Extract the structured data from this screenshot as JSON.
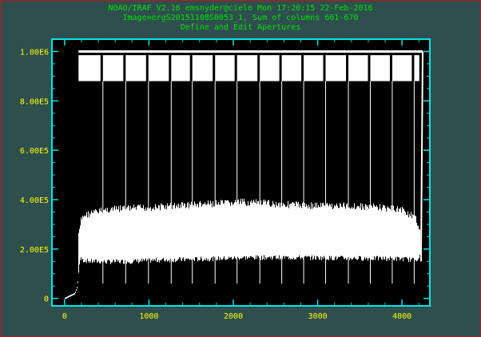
{
  "header": {
    "line1": "NOAO/IRAF V2.16 emsnyder@cielo Mon 17:20:15 22-Feb-2016",
    "line2": "Image=ergS20151108S0053_1, Sum of columns 661-670",
    "line3": "Define and Edit Apertures"
  },
  "colors": {
    "background": "#2f4f4f",
    "axes": "#00e5e5",
    "tick_labels": "#ffff00",
    "header_text": "#00e600",
    "plot_area": "#000000",
    "data": "#ffffff",
    "window_border": "#c01616"
  },
  "chart_data": {
    "type": "line",
    "title": "Define and Edit Apertures",
    "xlabel": "",
    "ylabel": "",
    "xlim": [
      -150,
      4330
    ],
    "ylim": [
      -30000,
      1050000
    ],
    "xticks": [
      0,
      1000,
      2000,
      3000,
      4000
    ],
    "xtick_labels": [
      "0",
      "1000",
      "2000",
      "3000",
      "4000"
    ],
    "yticks": [
      0,
      200000,
      400000,
      600000,
      800000,
      1000000
    ],
    "ytick_labels": [
      "0",
      "2.00E5",
      "4.00E5",
      "6.00E5",
      "8.00E5",
      "1.00E6"
    ],
    "grid": false,
    "series": [
      {
        "x_range": [
          0,
          4250
        ],
        "baseline": {
          "x": [
            0,
            60,
            120,
            150,
            170,
            185,
            210,
            300,
            500,
            800,
            1100,
            1500,
            1900,
            2100,
            2500,
            2900,
            3300,
            3700,
            4000,
            4150,
            4210
          ],
          "y": [
            0,
            10000,
            20000,
            50000,
            150000,
            170000,
            165000,
            160000,
            158000,
            160000,
            165000,
            168000,
            172000,
            175000,
            176000,
            175000,
            173000,
            172000,
            170000,
            165000,
            180000
          ]
        },
        "envelope": {
          "x": [
            170,
            190,
            220,
            300,
            500,
            800,
            1100,
            1500,
            1900,
            2100,
            2500,
            2900,
            3300,
            3700,
            4000,
            4150,
            4210
          ],
          "y": [
            280000,
            330000,
            350000,
            360000,
            375000,
            380000,
            385000,
            395000,
            400000,
            405000,
            398000,
            392000,
            390000,
            385000,
            375000,
            340000,
            300000
          ]
        },
        "saturated_columns": {
          "x_range": [
            165,
            4205
          ],
          "y_range": [
            880000,
            985000
          ]
        },
        "spikes_x": [
          440,
          710,
          980,
          1250,
          1500,
          1770,
          2030,
          2300,
          2560,
          2820,
          3080,
          3350,
          3610,
          3870,
          4130
        ],
        "spike_y": 1000000,
        "edge_spike": {
          "x": [
            4225,
            4245
          ],
          "y": [
            0,
            1000000
          ]
        }
      }
    ]
  }
}
